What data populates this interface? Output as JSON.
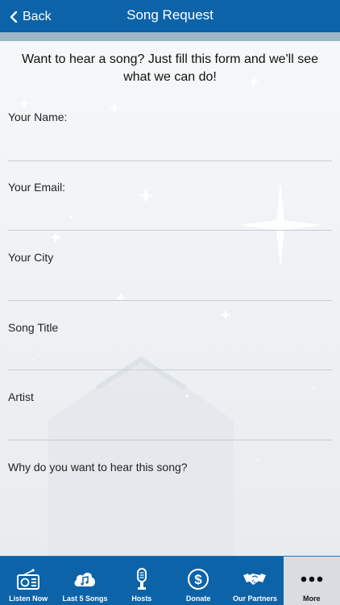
{
  "header": {
    "back_label": "Back",
    "title": "Song Request"
  },
  "form": {
    "intro": "Want to hear a song? Just fill this form and we'll see what we can do!",
    "fields": [
      {
        "label": "Your Name:",
        "value": ""
      },
      {
        "label": "Your Email:",
        "value": ""
      },
      {
        "label": "Your City",
        "value": ""
      },
      {
        "label": "Song Title",
        "value": ""
      },
      {
        "label": "Artist",
        "value": ""
      },
      {
        "label": "Why do you want to hear this song?",
        "value": ""
      }
    ]
  },
  "tabbar": {
    "items": [
      {
        "label": "Listen Now",
        "icon": "radio-icon"
      },
      {
        "label": "Last 5 Songs",
        "icon": "music-cloud-icon"
      },
      {
        "label": "Hosts",
        "icon": "microphone-icon"
      },
      {
        "label": "Donate",
        "icon": "dollar-icon"
      },
      {
        "label": "Our Partners",
        "icon": "handshake-icon"
      },
      {
        "label": "More",
        "icon": "more-icon"
      }
    ],
    "active_index": 5
  },
  "colors": {
    "primary": "#0d63a8",
    "strip": "#9db7c9",
    "active_tab": "#d9dde2"
  }
}
